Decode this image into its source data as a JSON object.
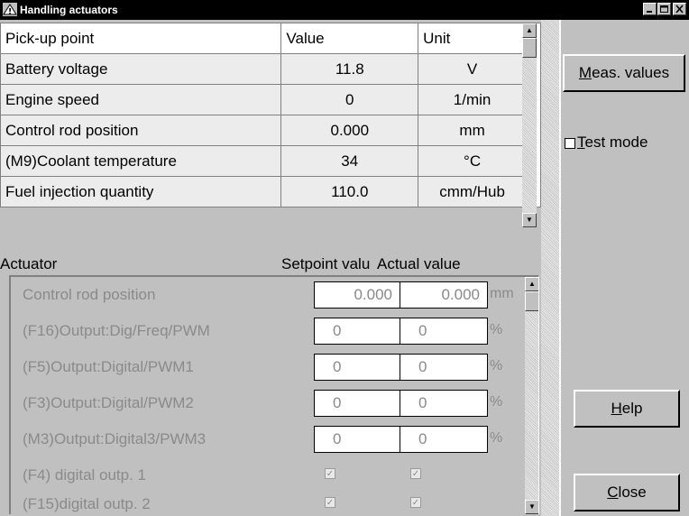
{
  "window": {
    "title": "Handling actuators"
  },
  "meas_table": {
    "headers": [
      "Pick-up point",
      "Value",
      "Unit"
    ],
    "rows": [
      [
        "Battery voltage",
        "11.8",
        "V"
      ],
      [
        "Engine speed",
        "0",
        "1/min"
      ],
      [
        "Control rod position",
        "0.000",
        "mm"
      ],
      [
        "(M9)Coolant temperature",
        "34",
        "°C"
      ],
      [
        "Fuel injection quantity",
        "110.0",
        "cmm/Hub"
      ]
    ]
  },
  "actuator_header": {
    "actuator": "Actuator",
    "setpoint": "Setpoint valu",
    "actual": "Actual value"
  },
  "actuators": [
    {
      "label": "Control rod position",
      "setpoint": "0.000",
      "actual": "0.000",
      "unit": "mm"
    },
    {
      "label": "(F16)Output:Dig/Freq/PWM",
      "setpoint": "0",
      "actual": "0",
      "unit": "%"
    },
    {
      "label": "(F5)Output:Digital/PWM1",
      "setpoint": "0",
      "actual": "0",
      "unit": "%"
    },
    {
      "label": "(F3)Output:Digital/PWM2",
      "setpoint": "0",
      "actual": "0",
      "unit": "%"
    },
    {
      "label": "(M3)Output:Digital3/PWM3",
      "setpoint": "0",
      "actual": "0",
      "unit": "%"
    },
    {
      "label": "(F4) digital outp. 1",
      "setpoint_checked": true,
      "actual_checked": true
    },
    {
      "label": "(F15)digital outp. 2",
      "setpoint_checked": true,
      "actual_checked": true
    }
  ],
  "right_panel": {
    "meas_values_button": {
      "prefix": "M",
      "rest": "eas. values"
    },
    "test_mode": {
      "prefix": "T",
      "rest": "est mode",
      "checked": false
    },
    "help_button": {
      "prefix": "H",
      "rest": "elp"
    },
    "close_button": {
      "prefix": "C",
      "rest": "lose"
    }
  },
  "icons": {
    "app": "warning-triangle-icon",
    "minimize": "minimize-icon",
    "maximize": "maximize-icon",
    "close": "close-icon",
    "scroll_up": "scroll-up-arrow-icon",
    "scroll_down": "scroll-down-arrow-icon",
    "check": "checkmark-icon"
  }
}
